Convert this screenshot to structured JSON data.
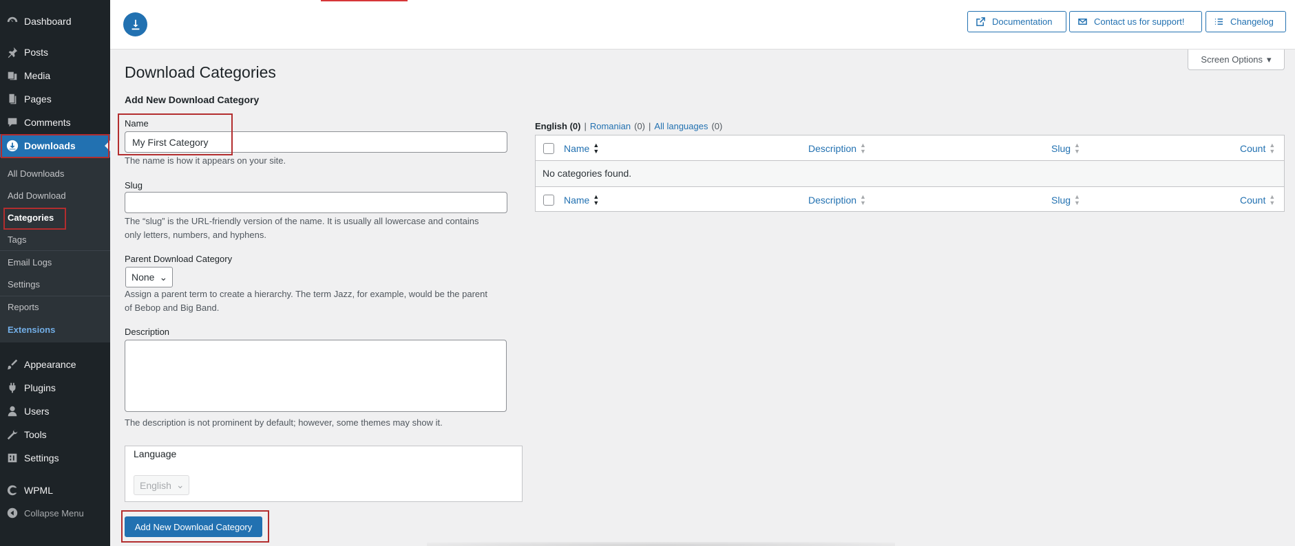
{
  "sidebar": {
    "items": [
      {
        "label": "Dashboard",
        "icon": "dashboard-icon"
      },
      {
        "label": "Posts",
        "icon": "pin-icon"
      },
      {
        "label": "Media",
        "icon": "media-icon"
      },
      {
        "label": "Pages",
        "icon": "page-icon"
      },
      {
        "label": "Comments",
        "icon": "comment-icon"
      },
      {
        "label": "Downloads",
        "icon": "download-icon"
      },
      {
        "label": "Appearance",
        "icon": "brush-icon"
      },
      {
        "label": "Plugins",
        "icon": "plugin-icon"
      },
      {
        "label": "Users",
        "icon": "user-icon"
      },
      {
        "label": "Tools",
        "icon": "wrench-icon"
      },
      {
        "label": "Settings",
        "icon": "settings-icon"
      },
      {
        "label": "WPML",
        "icon": "wpml-icon"
      },
      {
        "label": "Collapse Menu",
        "icon": "collapse-icon"
      }
    ],
    "submenu": [
      "All Downloads",
      "Add Download",
      "Categories",
      "Tags",
      "Email Logs",
      "Settings",
      "Reports",
      "Extensions"
    ]
  },
  "header": {
    "buttons": [
      "Documentation",
      "Contact us for support!",
      "Changelog"
    ],
    "screen_options": "Screen Options"
  },
  "page": {
    "title": "Download Categories",
    "form_title": "Add New Download Category",
    "name_label": "Name",
    "name_value": "My First Category",
    "name_help": "The name is how it appears on your site.",
    "slug_label": "Slug",
    "slug_value": "",
    "slug_help_1": "The “slug” is the URL-friendly version of the name. It is usually all lowercase and contains",
    "slug_help_2": "only letters, numbers, and hyphens.",
    "parent_label": "Parent Download Category",
    "parent_value": "None",
    "parent_help_1": "Assign a parent term to create a hierarchy. The term Jazz, for example, would be the parent",
    "parent_help_2": "of Bebop and Big Band.",
    "description_label": "Description",
    "description_help": "The description is not prominent by default; however, some themes may show it.",
    "language_label": "Language",
    "language_value": "English",
    "submit_label": "Add New Download Category"
  },
  "table": {
    "filters": [
      {
        "label": "English",
        "count": "(0)"
      },
      {
        "label": "Romanian",
        "count": "(0)"
      },
      {
        "label": "All languages",
        "count": "(0)"
      }
    ],
    "separator": "|",
    "columns": [
      "Name",
      "Description",
      "Slug",
      "Count"
    ],
    "empty_message": "No categories found."
  },
  "colors": {
    "sidebar_bg": "#1d2327",
    "accent": "#2271b1",
    "highlight": "#b32d2e"
  }
}
